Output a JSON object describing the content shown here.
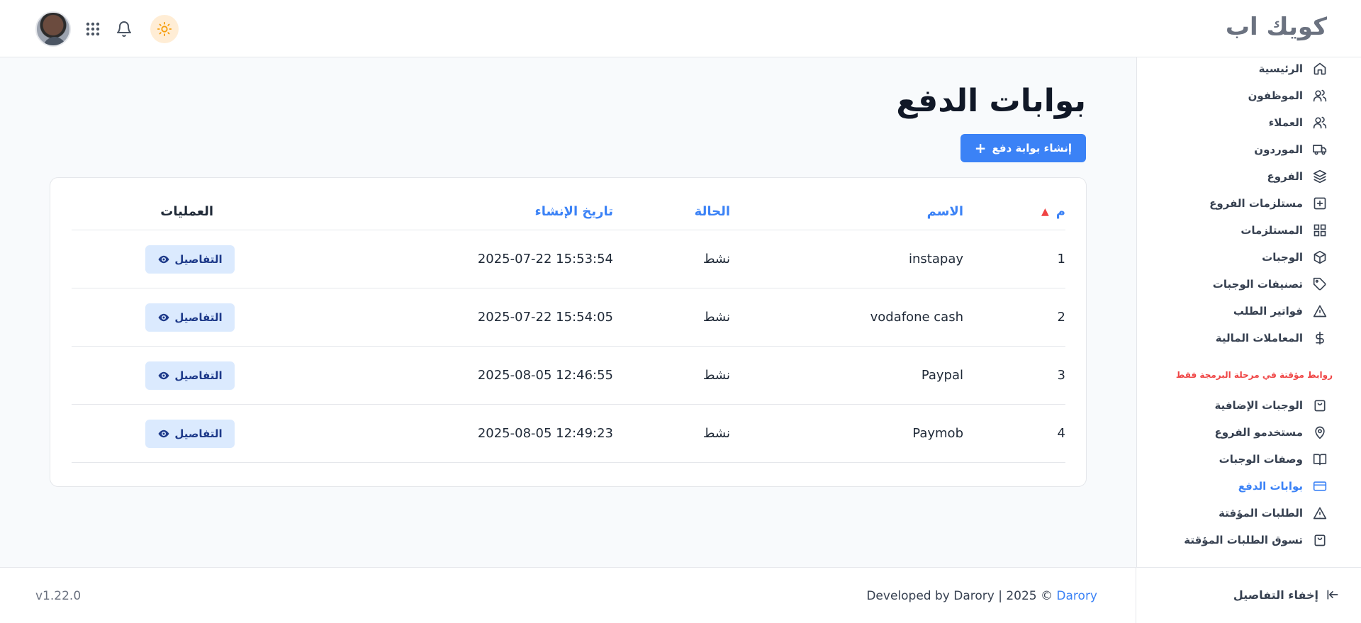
{
  "header": {
    "brand": "كويك اب"
  },
  "sidebar": {
    "items": [
      {
        "label": "الرئيسية",
        "icon": "home-icon"
      },
      {
        "label": "الموظفون",
        "icon": "users-icon"
      },
      {
        "label": "العملاء",
        "icon": "users-icon"
      },
      {
        "label": "الموردون",
        "icon": "truck-icon"
      },
      {
        "label": "الفروع",
        "icon": "layers-icon"
      },
      {
        "label": "مستلزمات الفروع",
        "icon": "plus-square-icon"
      },
      {
        "label": "المستلزمات",
        "icon": "grid-icon"
      },
      {
        "label": "الوجبات",
        "icon": "box-icon"
      },
      {
        "label": "تصنيفات الوجبات",
        "icon": "tag-icon"
      },
      {
        "label": "فواتير الطلب",
        "icon": "alert-triangle-icon"
      },
      {
        "label": "المعاملات المالية",
        "icon": "dollar-icon"
      }
    ],
    "temp_note": "روابط مؤقتة في مرحلة البرمجة فقط",
    "temp_items": [
      {
        "label": "الوجبات الإضافية",
        "icon": "shopping-bag-icon"
      },
      {
        "label": "مستخدمو الفروع",
        "icon": "map-pin-icon"
      },
      {
        "label": "وصفات الوجبات",
        "icon": "book-open-icon"
      },
      {
        "label": "بوابات الدفع",
        "icon": "credit-card-icon",
        "active": true
      },
      {
        "label": "الطلبات المؤقتة",
        "icon": "alert-triangle-icon"
      },
      {
        "label": "تسوق الطلبات المؤقتة",
        "icon": "shopping-bag-icon"
      }
    ],
    "collapse_label": "إخفاء التفاصيل"
  },
  "main": {
    "title": "بوابات الدفع",
    "create_button": "إنشاء بوابة دفع",
    "table": {
      "headers": {
        "index": "م",
        "name": "الاسم",
        "status": "الحالة",
        "created": "تاريخ الإنشاء",
        "ops": "العمليات"
      },
      "details_label": "التفاصيل",
      "rows": [
        {
          "index": "1",
          "name": "instapay",
          "status": "نشط",
          "created": "2025-07-22 15:53:54"
        },
        {
          "index": "2",
          "name": "vodafone cash",
          "status": "نشط",
          "created": "2025-07-22 15:54:05"
        },
        {
          "index": "3",
          "name": "Paypal",
          "status": "نشط",
          "created": "2025-08-05 12:46:55"
        },
        {
          "index": "4",
          "name": "Paymob",
          "status": "نشط",
          "created": "2025-08-05 12:49:23"
        }
      ]
    }
  },
  "footer": {
    "version": "v1.22.0",
    "credit_prefix": "Developed by Darory | 2025 ©",
    "credit_link": "Darory"
  },
  "colors": {
    "accent": "#3b82f6",
    "note": "#ef4444"
  }
}
